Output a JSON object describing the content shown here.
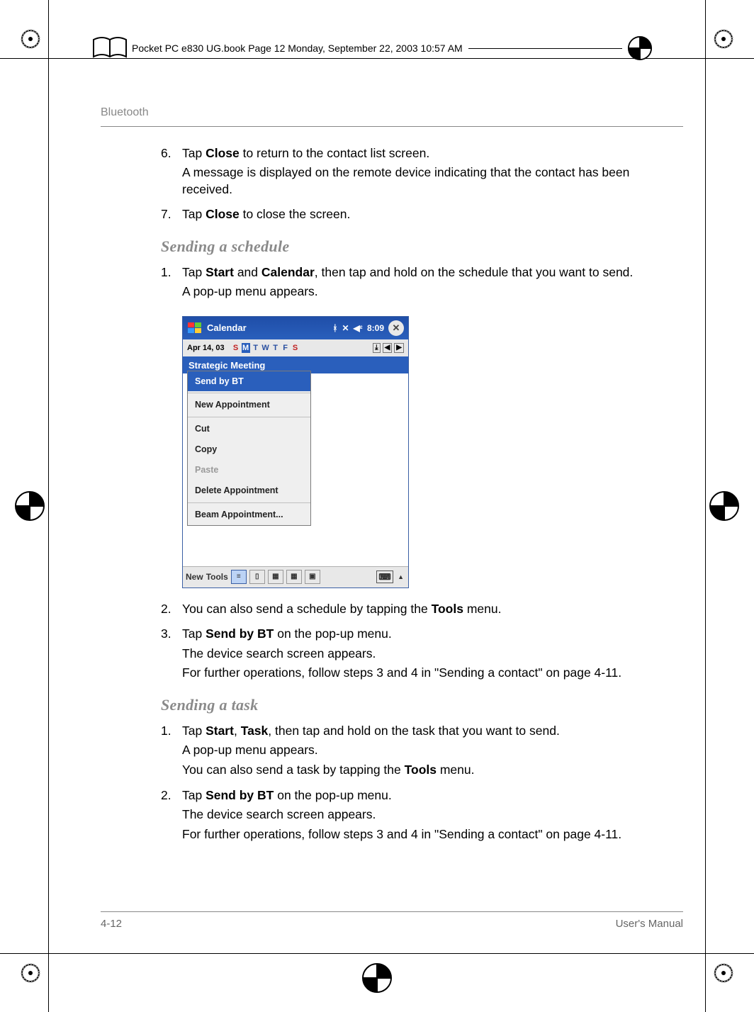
{
  "book_header": "Pocket PC e830 UG.book  Page 12  Monday, September 22, 2003  10:57 AM",
  "running_head": "Bluetooth",
  "step6": {
    "num": "6.",
    "line1_a": "Tap ",
    "line1_b": "Close",
    "line1_c": " to return to the contact list screen.",
    "line2": "A message is displayed on the remote device indicating that the contact has been received."
  },
  "step7": {
    "num": "7.",
    "a": "Tap ",
    "b": "Close",
    "c": " to close the screen."
  },
  "heading_schedule": "Sending a schedule",
  "sched1": {
    "num": "1.",
    "a": "Tap ",
    "b": "Start",
    "c": " and ",
    "d": "Calendar",
    "e": ", then tap and hold on the schedule that you want to send.",
    "f": "A pop-up menu appears."
  },
  "ppc": {
    "title": "Calendar",
    "time": "8:09",
    "datebar": "Apr 14, 03",
    "days": [
      "S",
      "M",
      "T",
      "W",
      "T",
      "F",
      "S"
    ],
    "meeting": "Strategic Meeting",
    "menu": {
      "send_bt": "Send by BT",
      "new": "New Appointment",
      "cut": "Cut",
      "copy": "Copy",
      "paste": "Paste",
      "delete": "Delete Appointment",
      "beam": "Beam Appointment..."
    },
    "toolbar": {
      "new": "New",
      "tools": "Tools"
    }
  },
  "sched2": {
    "num": "2.",
    "a": "You can also send a schedule by tapping the ",
    "b": "Tools",
    "c": " menu."
  },
  "sched3": {
    "num": "3.",
    "a": "Tap ",
    "b": "Send by BT",
    "c": " on the pop-up menu.",
    "d": "The device search screen appears.",
    "e": "For further operations, follow steps 3 and 4 in \"Sending a contact\" on page 4-11."
  },
  "heading_task": "Sending a task",
  "task1": {
    "num": "1.",
    "a": "Tap ",
    "b": "Start",
    "c": ", ",
    "d": "Task",
    "e": ", then tap and hold on the task that you want to send.",
    "f": "A pop-up menu appears.",
    "g": "You can also send a task by tapping the ",
    "h": "Tools",
    "i": " menu."
  },
  "task2": {
    "num": "2.",
    "a": "Tap ",
    "b": "Send by BT",
    "c": " on the pop-up menu.",
    "d": "The device search screen appears.",
    "e": "For further operations, follow steps 3 and 4 in \"Sending a contact\" on page 4-11."
  },
  "footer": {
    "page": "4-12",
    "manual": "User's Manual"
  }
}
